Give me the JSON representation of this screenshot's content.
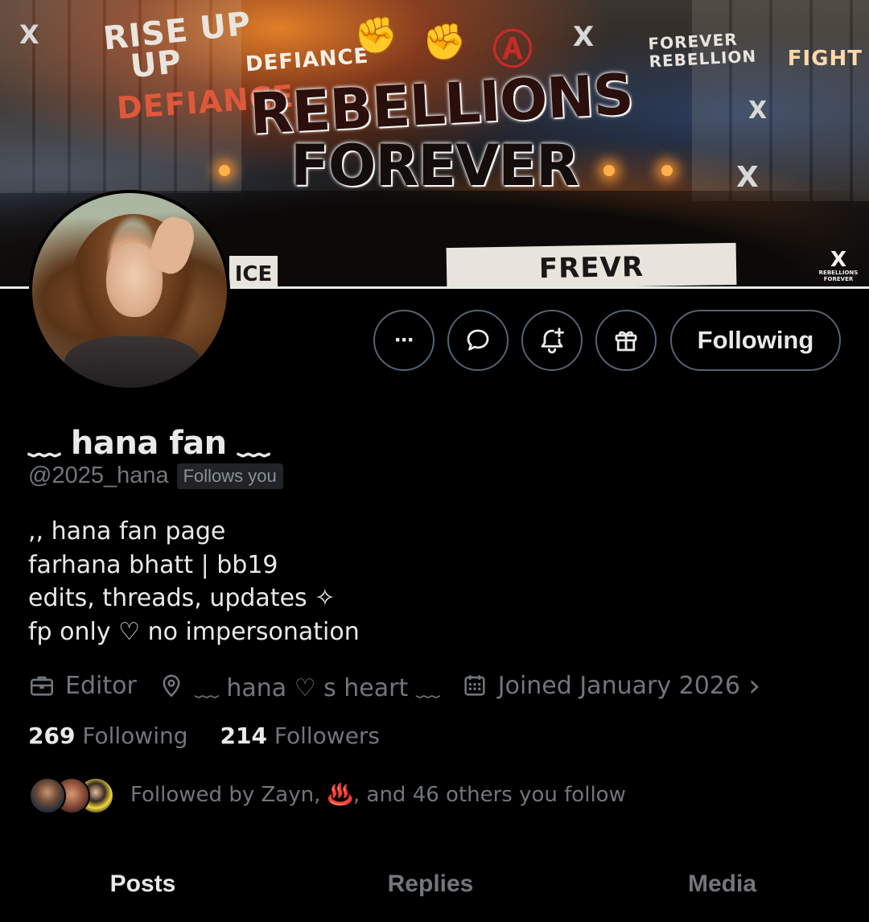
{
  "banner": {
    "title_line1": "REBELLIONS",
    "title_line2": "FOREVER",
    "graffiti_rise": "RISE UP",
    "graffiti_up": "UP",
    "graffiti_defiance_top": "DEFIANCE",
    "graffiti_defiance_left": "DEFIANCE",
    "sign_forever": "FOREVER",
    "sign_rebellion": "REBELLION",
    "graffiti_fight": "FIGHT",
    "protest_sign": "FREVR REBELLION",
    "protest_sign_left": "ICE",
    "corner_logo_line1": "REBELLIONS",
    "corner_logo_line2": "FOREVER",
    "x_glyph": "X",
    "fist_glyph": "✊",
    "anarchy_glyph": "Ⓐ"
  },
  "actions": {
    "more_label": "···",
    "follow_label": "Following"
  },
  "profile": {
    "display_name": "﹏ hana fan ﹏",
    "handle": "@2025_hana",
    "follows_you": "Follows you",
    "bio": [
      ",, hana fan page",
      "farhana bhatt | bb19",
      "edits, threads, updates ✧",
      "fp only ♡ no impersonation"
    ],
    "category": "Editor",
    "location": "﹏ hana ♡ s heart ﹏",
    "joined": "Joined January 2026",
    "joined_chevron": "›"
  },
  "stats": {
    "following_count": "269",
    "following_label": "Following",
    "followers_count": "214",
    "followers_label": "Followers"
  },
  "followed_by": "Followed by Zayn, ♨️, and 46 others you follow",
  "tabs": [
    {
      "label": "Posts",
      "active": true
    },
    {
      "label": "Replies",
      "active": false
    },
    {
      "label": "Media",
      "active": false
    }
  ],
  "colors": {
    "background": "#000000",
    "text_primary": "#e7e9ea",
    "text_secondary": "#71767b",
    "border": "#536471",
    "badge_bg": "#202327"
  },
  "icons": {
    "more": "more-icon",
    "message": "message-icon",
    "notify": "bell-plus-icon",
    "gift": "gift-icon",
    "category": "briefcase-icon",
    "location": "location-pin-icon",
    "joined": "calendar-icon"
  }
}
